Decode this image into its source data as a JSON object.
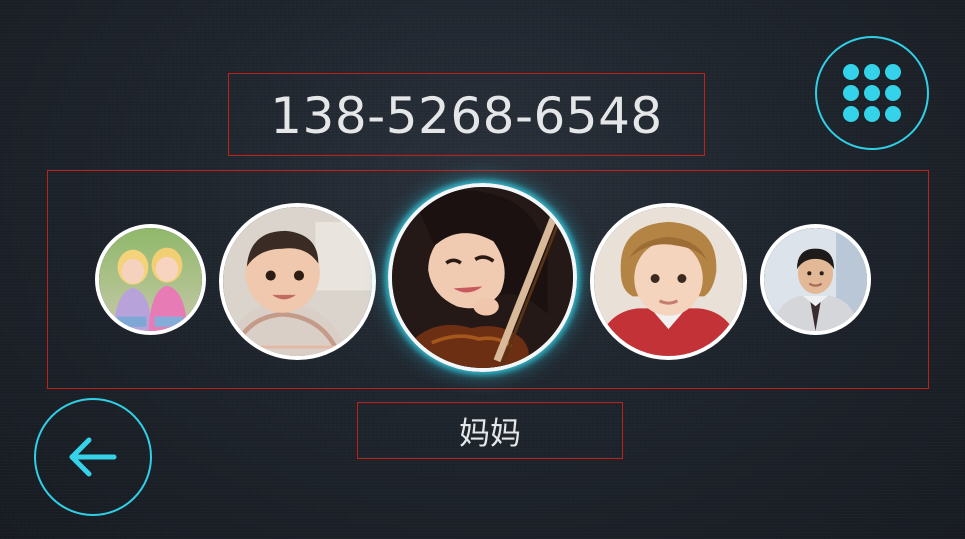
{
  "dialer": {
    "phone_number": "138-5268-6548",
    "selected_contact_name": "妈妈"
  },
  "contacts": [
    {
      "id": "twin-girls",
      "icon": "contact-photo-twin-girls"
    },
    {
      "id": "toddler",
      "icon": "contact-photo-toddler"
    },
    {
      "id": "mom-violin",
      "icon": "contact-photo-woman-violin",
      "selected": true
    },
    {
      "id": "boy",
      "icon": "contact-photo-boy"
    },
    {
      "id": "man-suit",
      "icon": "contact-photo-man-suit"
    }
  ],
  "controls": {
    "keypad_icon": "keypad-icon",
    "back_icon": "back-arrow-icon"
  },
  "colors": {
    "accent": "#34d3ea",
    "annotation_border": "#c0201c",
    "text": "#e4e6e8",
    "background": "#1f252d"
  }
}
